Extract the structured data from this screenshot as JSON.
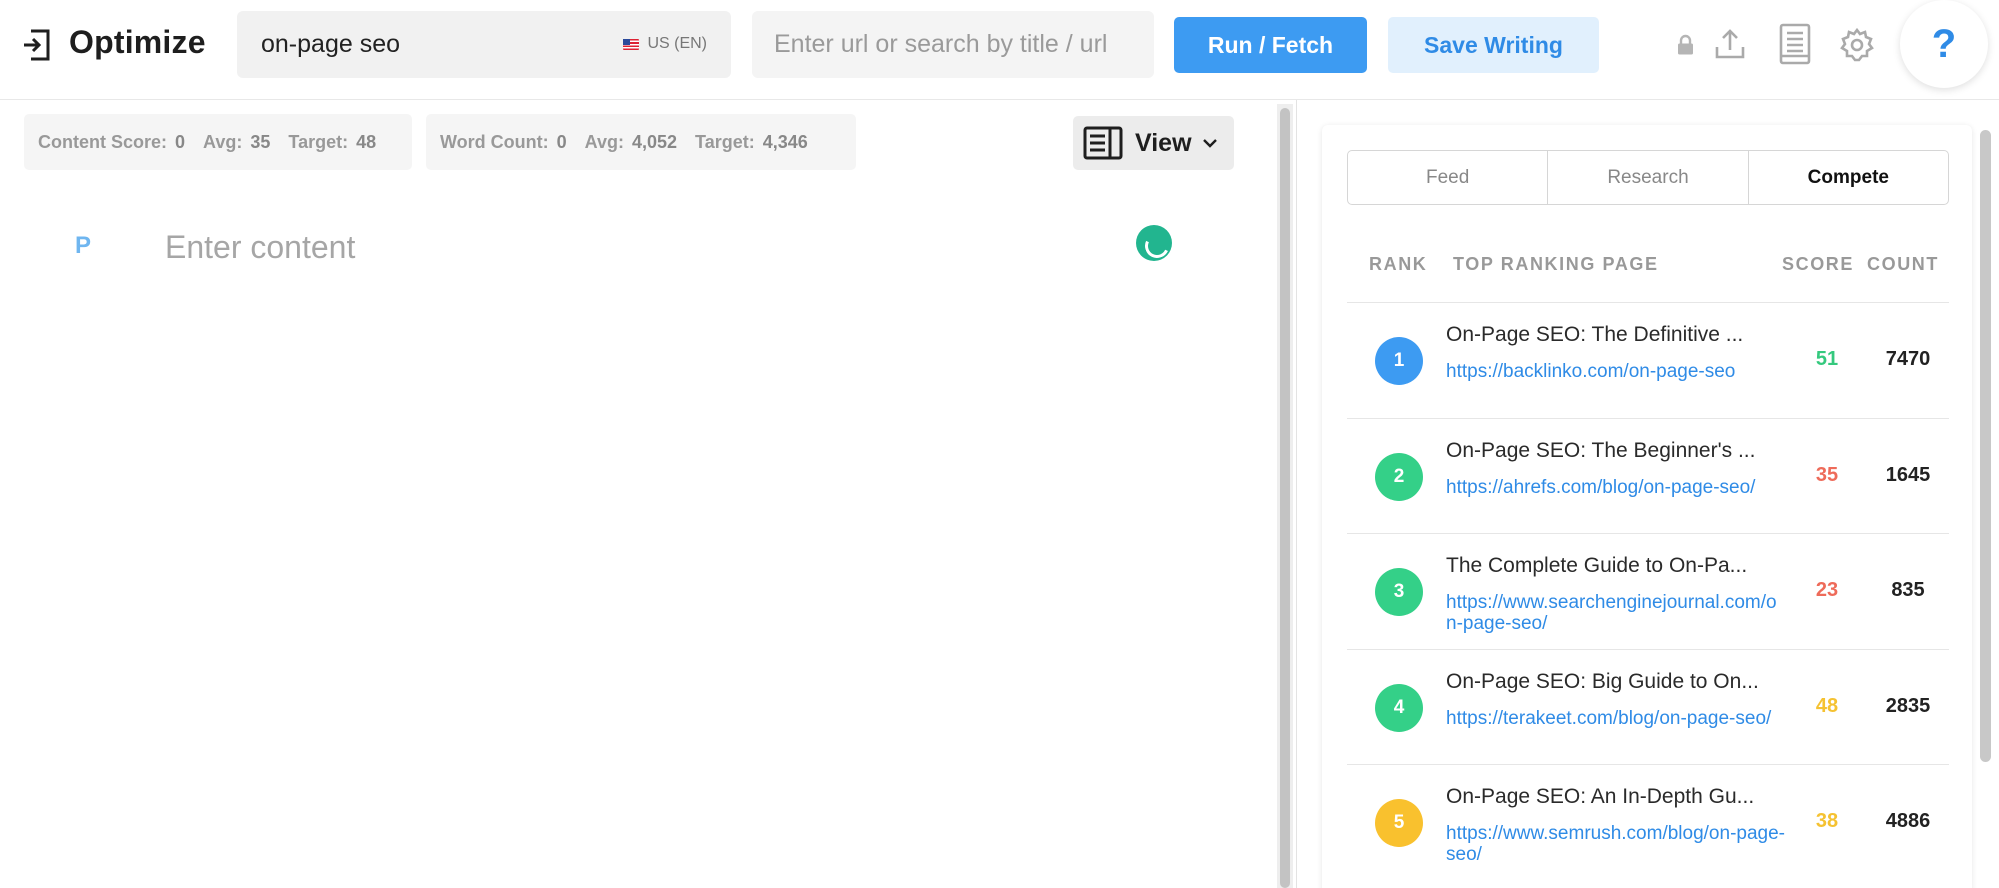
{
  "app": {
    "title": "Optimize"
  },
  "keyword": {
    "value": "on-page seo",
    "locale": "US (EN)"
  },
  "url_search": {
    "placeholder": "Enter url or search by title / url"
  },
  "toolbar": {
    "run_label": "Run / Fetch",
    "save_label": "Save Writing",
    "help_label": "?"
  },
  "icons": [
    "exit-icon",
    "flag-icon",
    "lock-icon",
    "upload-icon",
    "document-icon",
    "gear-icon",
    "help-icon",
    "view-layout-icon",
    "chevron-down-icon",
    "spinner-icon"
  ],
  "editor": {
    "content_score": {
      "label": "Content Score:",
      "value": "0",
      "avg_label": "Avg:",
      "avg": "35",
      "target_label": "Target:",
      "target": "48"
    },
    "word_count": {
      "label": "Word Count:",
      "value": "0",
      "avg_label": "Avg:",
      "avg": "4,052",
      "target_label": "Target:",
      "target": "4,346"
    },
    "view_label": "View",
    "paragraph_tag": "P",
    "content_placeholder": "Enter content"
  },
  "panel": {
    "tabs": [
      {
        "label": "Feed",
        "active": false
      },
      {
        "label": "Research",
        "active": false
      },
      {
        "label": "Compete",
        "active": true
      }
    ],
    "columns": {
      "rank": "RANK",
      "page": "TOP RANKING PAGE",
      "score": "SCORE",
      "count": "COUNT"
    },
    "rows": [
      {
        "rank": "1",
        "title": "On-Page SEO: The Definitive ...",
        "url": "https://backlinko.com/on-page-seo",
        "score": "51",
        "count": "7470",
        "rank_color": "#3d9bf2",
        "score_color": "#35c97e"
      },
      {
        "rank": "2",
        "title": "On-Page SEO: The Beginner's ...",
        "url": "https://ahrefs.com/blog/on-page-seo/",
        "score": "35",
        "count": "1645",
        "rank_color": "#34d088",
        "score_color": "#ee6b5a"
      },
      {
        "rank": "3",
        "title": "The Complete Guide to On-Pa...",
        "url": "https://www.searchenginejournal.com/on-page-seo/",
        "score": "23",
        "count": "835",
        "rank_color": "#34d088",
        "score_color": "#ee6b5a"
      },
      {
        "rank": "4",
        "title": "On-Page SEO: Big Guide to On...",
        "url": "https://terakeet.com/blog/on-page-seo/",
        "score": "48",
        "count": "2835",
        "rank_color": "#34d088",
        "score_color": "#f5c232"
      },
      {
        "rank": "5",
        "title": "On-Page SEO: An In-Depth Gu...",
        "url": "https://www.semrush.com/blog/on-page-seo/",
        "score": "38",
        "count": "4886",
        "rank_color": "#f9c12e",
        "score_color": "#f5c232"
      }
    ]
  },
  "colors": {
    "accent": "#3d9bf2",
    "accent_light": "#e1f0fd",
    "link": "#2f8be6",
    "spinner": "#22b58f"
  }
}
